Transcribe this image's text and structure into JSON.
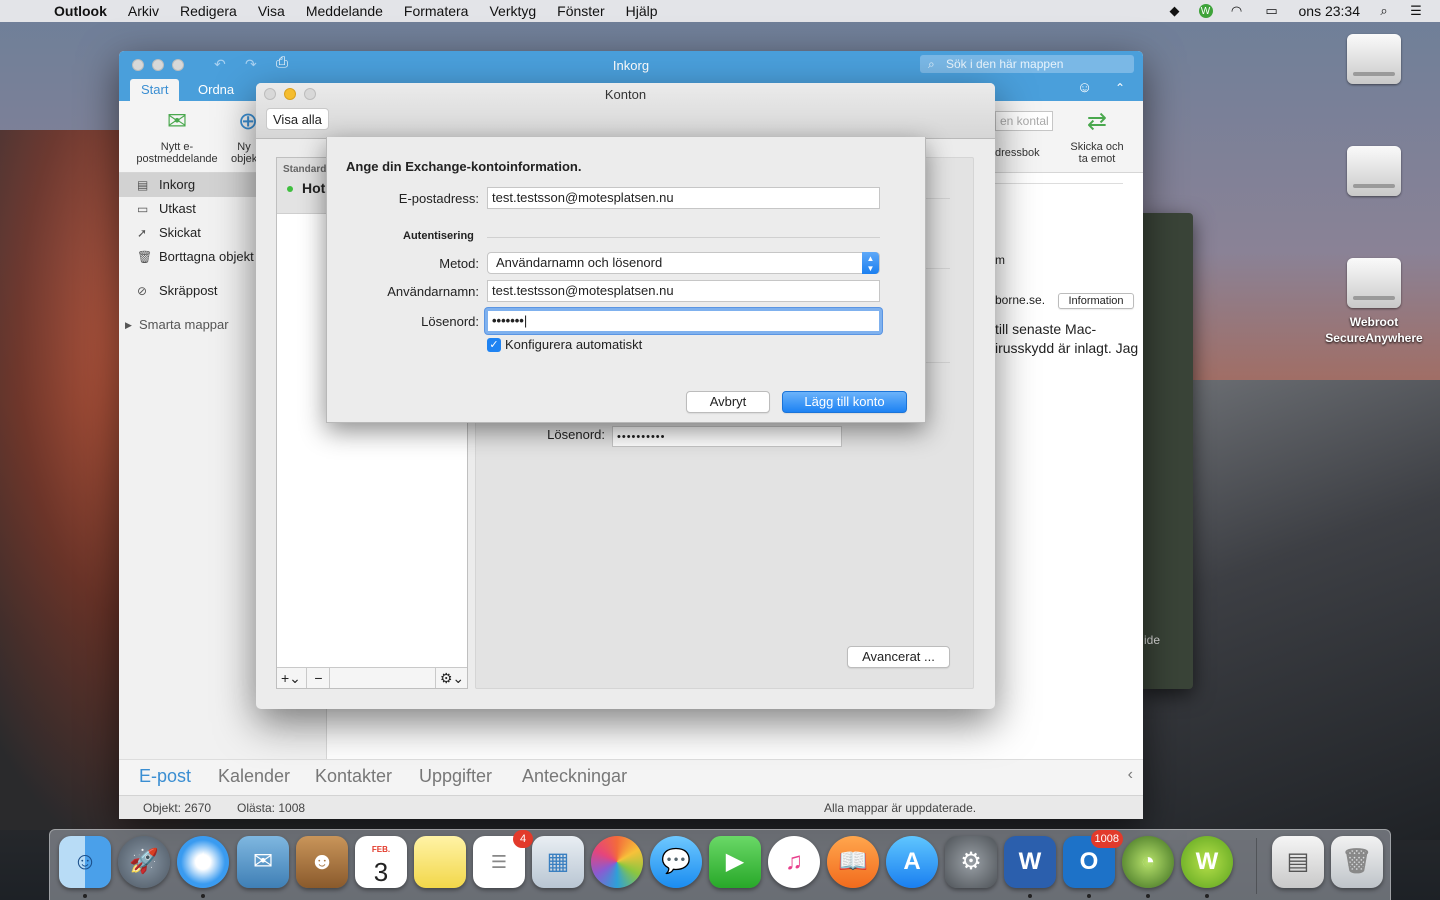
{
  "menubar": {
    "app": "Outlook",
    "items": [
      "Arkiv",
      "Redigera",
      "Visa",
      "Meddelande",
      "Formatera",
      "Verktyg",
      "Fönster",
      "Hjälp"
    ],
    "clock": "ons 23:34"
  },
  "desktop": {
    "webroot_label": "Webroot SecureAnywhere"
  },
  "outlook": {
    "title": "Inkorg",
    "search_placeholder": "Sök i den här mappen",
    "tabs": [
      "Start",
      "Ordna"
    ],
    "ribbon": {
      "new_mail": "Nytt e-postmeddelande",
      "new_items": "Ny objekt",
      "contact_search": "en kontal",
      "address_book": "dressbok",
      "send_receive": "Skicka och ta emot"
    },
    "folders": [
      "Inkorg",
      "Utkast",
      "Skickat",
      "Borttagna objekt",
      "Skräppost",
      "Smarta mappar"
    ],
    "content": {
      "line_m": "m",
      "sender": "borne.se.",
      "info_button": "Information",
      "body1": "till senaste Mac-",
      "body2": "irusskydd är inlagt. Jag"
    },
    "nav": [
      "E-post",
      "Kalender",
      "Kontakter",
      "Uppgifter",
      "Anteckningar"
    ],
    "status": {
      "items": "Objekt: 2670",
      "unread": "Olästa: 1008",
      "sync": "Alla mappar är uppdaterade."
    }
  },
  "accounts": {
    "title": "Konton",
    "show_all": "Visa alla",
    "list_header": "Standard",
    "list_item": "Hot",
    "password_label": "Lösenord:",
    "password_value": "••••••••••",
    "advanced_button": "Avancerat ..."
  },
  "sheet": {
    "heading": "Ange din Exchange-kontoinformation.",
    "email_label": "E-postadress:",
    "email_value": "test.testsson@motesplatsen.nu",
    "auth_section": "Autentisering",
    "method_label": "Metod:",
    "method_value": "Användarnamn och lösenord",
    "username_label": "Användarnamn:",
    "username_value": "test.testsson@motesplatsen.nu",
    "password_label": "Lösenord:",
    "password_value": "•••••••",
    "auto_config": "Konfigurera automatiskt",
    "cancel": "Avbryt",
    "add_account": "Lägg till konto"
  },
  "dock": {
    "calendar_month": "FEB.",
    "calendar_day": "3",
    "reminders_badge": "4",
    "outlook_badge": "1008"
  }
}
